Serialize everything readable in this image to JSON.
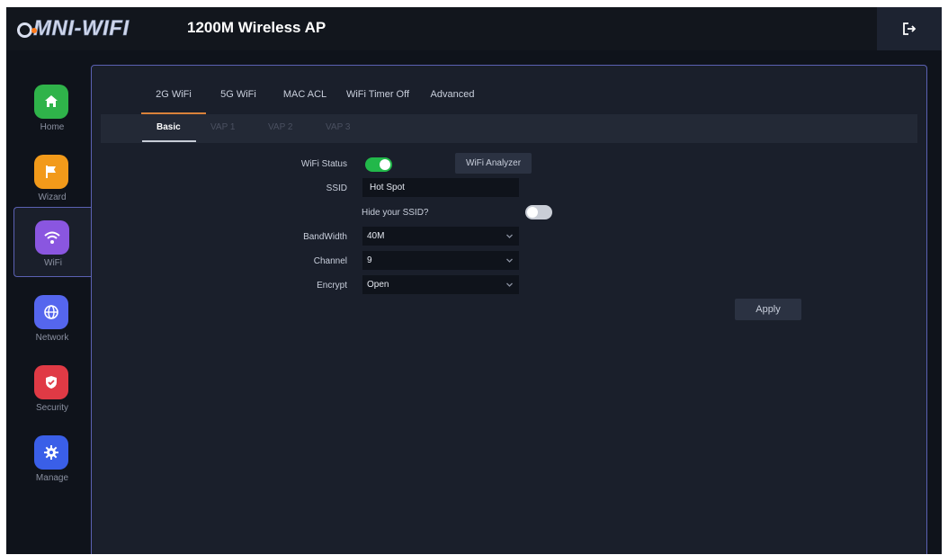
{
  "header": {
    "logo_text": "MNI-WIFI",
    "title": "1200M Wireless AP",
    "logout_icon": "logout-icon"
  },
  "sidebar": {
    "items": [
      {
        "label": "Home",
        "icon": "home-icon",
        "color": "#2fb34a"
      },
      {
        "label": "Wizard",
        "icon": "flag-icon",
        "color": "#f29a1a"
      },
      {
        "label": "WiFi",
        "icon": "wifi-icon",
        "color": "#8a56e0",
        "active": true
      },
      {
        "label": "Network",
        "icon": "globe-icon",
        "color": "#5566ee"
      },
      {
        "label": "Security",
        "icon": "shield-icon",
        "color": "#e03a45"
      },
      {
        "label": "Manage",
        "icon": "gear-icon",
        "color": "#3a5fe8"
      }
    ]
  },
  "tabs": [
    "2G WiFi",
    "5G WiFi",
    "MAC ACL",
    "WiFi Timer Off",
    "Advanced"
  ],
  "subtabs": [
    "Basic",
    "VAP 1",
    "VAP 2",
    "VAP 3"
  ],
  "form": {
    "wifi_status_label": "WiFi Status",
    "wifi_status_on": true,
    "analyzer_button": "WiFi Analyzer",
    "ssid_label": "SSID",
    "ssid_value": "Hot Spot",
    "hide_ssid_label": "Hide your SSID?",
    "hide_ssid_on": false,
    "bandwidth_label": "BandWidth",
    "bandwidth_value": "40M",
    "channel_label": "Channel",
    "channel_value": "9",
    "encrypt_label": "Encrypt",
    "encrypt_value": "Open",
    "apply_button": "Apply"
  },
  "colors": {
    "accent_tab": "#d9823a",
    "toggle_on": "#22b84a",
    "toggle_off": "#c9cdd6",
    "panel_border": "#5b61b3"
  }
}
